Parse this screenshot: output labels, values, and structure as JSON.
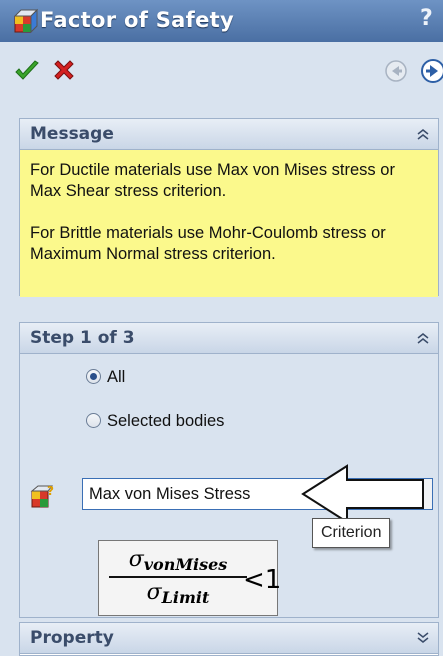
{
  "window": {
    "title": "Factor of Safety",
    "help": "?"
  },
  "message": {
    "title": "Message",
    "line1": "For Ductile materials use Max von Mises stress or Max Shear stress criterion.",
    "line2": "For Brittle materials use Mohr-Coulomb stress or Maximum Normal stress criterion."
  },
  "step": {
    "title": "Step 1 of 3",
    "option_all": "All",
    "option_selected": "Selected bodies",
    "criterion_value": "Max von Mises Stress",
    "tooltip": "Criterion",
    "formula": {
      "num_symbol": "σ",
      "num_sub": "vonMises",
      "den_symbol": "σ",
      "den_sub": "Limit",
      "rhs": "<1"
    }
  },
  "property": {
    "title": "Property"
  },
  "colors": {
    "titlebar": "#4a6fa3",
    "message_bg": "#fbf98c",
    "panel_header_text": "#3a4c6a",
    "ok_green": "#3aa52b",
    "cancel_red": "#d42020"
  },
  "icons": [
    "factor-of-safety-icon",
    "ok-check-icon",
    "cancel-x-icon",
    "back-arrow-icon",
    "forward-arrow-icon",
    "collapse-chevron-icon",
    "expand-chevron-icon",
    "criterion-icon"
  ]
}
